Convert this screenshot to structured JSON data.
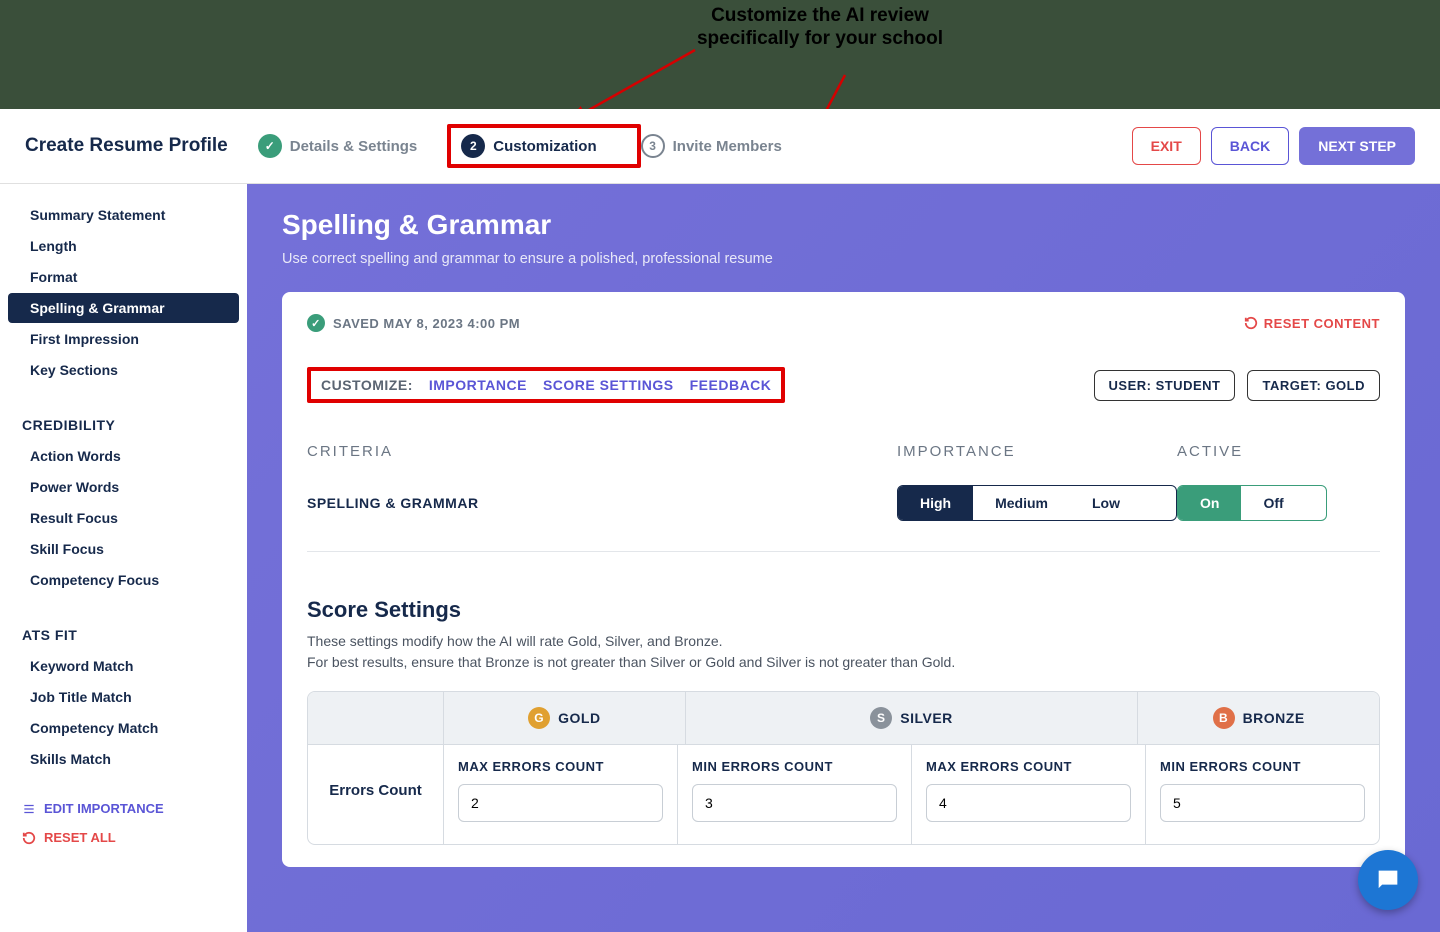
{
  "annotation": "Customize the AI review specifically for your school",
  "stepper": {
    "title": "Create Resume Profile",
    "steps": [
      {
        "label": "Details & Settings",
        "state": "done"
      },
      {
        "num": "2",
        "label": "Customization",
        "state": "active"
      },
      {
        "num": "3",
        "label": "Invite Members",
        "state": "pending"
      }
    ],
    "exit": "EXIT",
    "back": "BACK",
    "next": "NEXT STEP"
  },
  "sidebar": {
    "top": [
      "Summary Statement",
      "Length",
      "Format",
      "Spelling & Grammar",
      "First Impression",
      "Key Sections"
    ],
    "selected": "Spelling & Grammar",
    "groups": [
      {
        "head": "CREDIBILITY",
        "items": [
          "Action Words",
          "Power Words",
          "Result Focus",
          "Skill Focus",
          "Competency Focus"
        ]
      },
      {
        "head": "ATS FIT",
        "items": [
          "Keyword Match",
          "Job Title Match",
          "Competency Match",
          "Skills Match"
        ]
      }
    ],
    "edit": "EDIT IMPORTANCE",
    "reset": "RESET ALL"
  },
  "main": {
    "title": "Spelling & Grammar",
    "subtitle": "Use correct spelling and grammar to ensure a polished, professional resume",
    "saved": "SAVED MAY 8, 2023 4:00 PM",
    "reset": "RESET CONTENT",
    "customize": {
      "label": "CUSTOMIZE:",
      "links": [
        "IMPORTANCE",
        "SCORE SETTINGS",
        "FEEDBACK"
      ],
      "pills": [
        "USER: STUDENT",
        "TARGET: GOLD"
      ]
    },
    "criteria": {
      "heads": [
        "CRITERIA",
        "IMPORTANCE",
        "ACTIVE"
      ],
      "name": "SPELLING & GRAMMAR",
      "importance": {
        "options": [
          "High",
          "Medium",
          "Low"
        ],
        "selected": "High"
      },
      "active": {
        "options": [
          "On",
          "Off"
        ],
        "selected": "On"
      }
    },
    "score": {
      "title": "Score Settings",
      "desc1": "These settings modify how the AI will rate Gold, Silver, and Bronze.",
      "desc2": "For best results, ensure that Bronze is not greater than Silver or Gold and Silver is not greater than Gold.",
      "tiers": [
        "GOLD",
        "SILVER",
        "BRONZE"
      ],
      "rowlabel": "Errors Count",
      "cells": [
        {
          "label": "MAX ERRORS COUNT",
          "value": "2"
        },
        {
          "label": "MIN ERRORS COUNT",
          "value": "3"
        },
        {
          "label": "MAX ERRORS COUNT",
          "value": "4"
        },
        {
          "label": "MIN ERRORS COUNT",
          "value": "5"
        }
      ]
    }
  }
}
